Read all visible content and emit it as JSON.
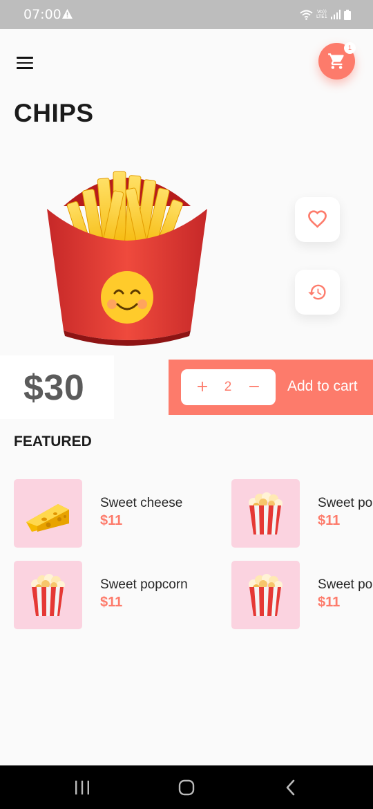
{
  "status_bar": {
    "time": "07:00",
    "network_line1": "Vo))",
    "network_line2": "LTE1"
  },
  "header": {
    "title": "CHIPS",
    "cart_count": "1"
  },
  "product": {
    "price": "$30",
    "quantity": "2",
    "plus_label": "+",
    "minus_label": "−",
    "add_to_cart_label": "Add to cart"
  },
  "featured": {
    "title": "FEATURED",
    "items": [
      {
        "name": "Sweet cheese",
        "price": "$11",
        "image": "cheese-icon"
      },
      {
        "name": "Sweet popcorn",
        "price": "$11",
        "image": "popcorn-icon"
      },
      {
        "name": "Sweet popcorn",
        "price": "$11",
        "image": "popcorn-icon"
      },
      {
        "name": "Sweet popcorn",
        "price": "$11",
        "image": "popcorn-icon"
      }
    ]
  },
  "colors": {
    "accent": "#fd7b6b",
    "thumb_bg": "#fbd3e0",
    "price_text": "#5b5b5b"
  }
}
